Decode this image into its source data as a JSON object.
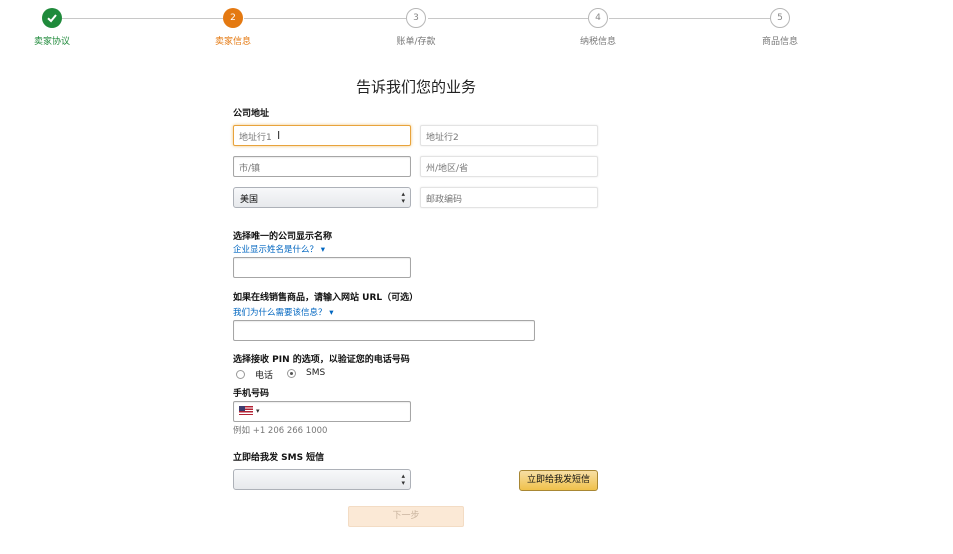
{
  "stepper": {
    "steps": [
      {
        "label": "卖家协议",
        "number": "",
        "state": "done"
      },
      {
        "label": "卖家信息",
        "number": "2",
        "state": "active"
      },
      {
        "label": "账单/存款",
        "number": "3",
        "state": "todo"
      },
      {
        "label": "纳税信息",
        "number": "4",
        "state": "todo"
      },
      {
        "label": "商品信息",
        "number": "5",
        "state": "todo"
      }
    ]
  },
  "form": {
    "title": "告诉我们您的业务",
    "address": {
      "label": "公司地址",
      "line1_placeholder": "地址行1",
      "line2_placeholder": "地址行2",
      "city_placeholder": "市/镇",
      "state_placeholder": "州/地区/省",
      "country_selected": "美国",
      "zip_placeholder": "邮政编码"
    },
    "display_name": {
      "label": "选择唯一的公司显示名称",
      "help_link": "企业显示姓名是什么？",
      "help_mark": "▾",
      "value": ""
    },
    "website": {
      "label": "如果在线销售商品，请输入网站 URL（可选）",
      "help_link": "我们为什么需要该信息？",
      "help_mark": "▾",
      "value": ""
    },
    "pin_option": {
      "label": "选择接收 PIN 的选项，以验证您的电话号码",
      "options": [
        {
          "label": "电话",
          "checked": false
        },
        {
          "label": "SMS",
          "checked": true
        }
      ]
    },
    "phone": {
      "label": "手机号码",
      "country_code_symbol": "▾",
      "value": "",
      "example": "例如 +1 206 266 1000"
    },
    "sms_language": {
      "label": "立即给我发 SMS 短信",
      "selected": ""
    },
    "send_sms_button": "立即给我发短信",
    "next_button": "下一步"
  },
  "colors": {
    "done": "#1f8a3b",
    "active": "#e47911",
    "link": "#0066c0",
    "button_primary": "#f0c14b"
  }
}
